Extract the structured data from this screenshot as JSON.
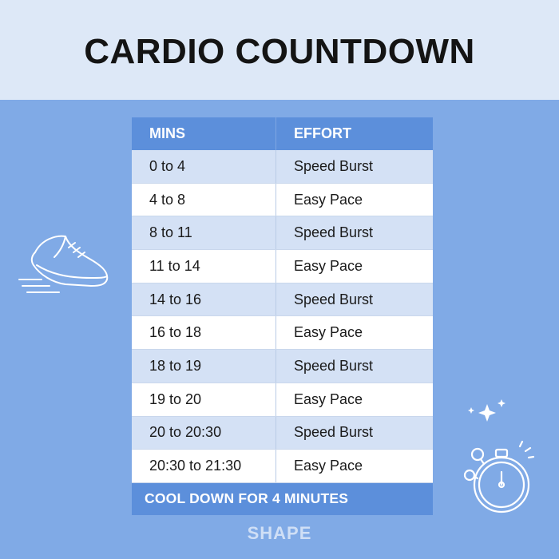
{
  "title": "CARDIO COUNTDOWN",
  "table": {
    "headers": [
      "MINS",
      "EFFORT"
    ],
    "rows": [
      {
        "mins": "0 to 4",
        "effort": "Speed Burst"
      },
      {
        "mins": "4 to 8",
        "effort": "Easy Pace"
      },
      {
        "mins": "8 to 11",
        "effort": "Speed Burst"
      },
      {
        "mins": "11 to 14",
        "effort": "Easy Pace"
      },
      {
        "mins": "14 to 16",
        "effort": "Speed Burst"
      },
      {
        "mins": "16 to 18",
        "effort": "Easy Pace"
      },
      {
        "mins": "18 to 19",
        "effort": "Speed Burst"
      },
      {
        "mins": "19 to 20",
        "effort": "Easy Pace"
      },
      {
        "mins": "20 to 20:30",
        "effort": "Speed Burst"
      },
      {
        "mins": "20:30 to 21:30",
        "effort": "Easy Pace"
      }
    ],
    "footer": "COOL DOWN FOR 4 MINUTES"
  },
  "brand": "SHAPE",
  "icons": {
    "shoe": "running-shoe-icon",
    "stopwatch": "stopwatch-icon",
    "sparkles": "sparkle-icon"
  },
  "colors": {
    "background": "#80aae6",
    "header_band": "#dde8f7",
    "table_header": "#5c8fdb",
    "row_alt": "#d4e1f5",
    "row_plain": "#ffffff"
  }
}
